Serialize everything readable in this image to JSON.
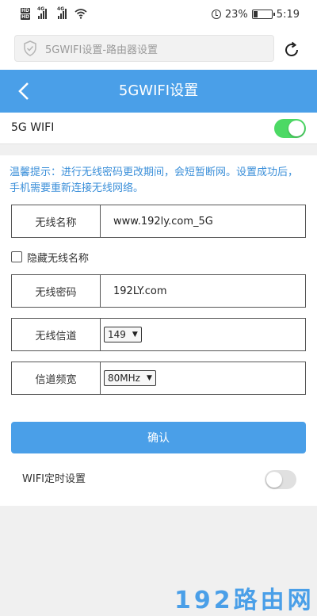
{
  "status_bar": {
    "hd1": "HD",
    "hd2": "HD",
    "net1": "4G",
    "net2": "4G",
    "battery": "23%",
    "battery_level": 0.23,
    "time": "5:19"
  },
  "address_bar": {
    "url_text": "5GWIFI设置-路由器设置"
  },
  "header": {
    "title": "5GWIFI设置"
  },
  "wifi_toggle": {
    "label": "5G WIFI",
    "enabled": true
  },
  "tip": "温馨提示：进行无线密码更改期间，会短暂断网。设置成功后，手机需要重新连接无线网络。",
  "form": {
    "ssid_label": "无线名称",
    "ssid_value": "www.192ly.com_5G",
    "hide_ssid_label": "隐藏无线名称",
    "hide_ssid_checked": false,
    "password_label": "无线密码",
    "password_value": "192LY.com",
    "channel_label": "无线信道",
    "channel_value": "149",
    "bandwidth_label": "信道频宽",
    "bandwidth_value": "80MHz"
  },
  "confirm_label": "确认",
  "timer": {
    "label": "WIFI定时设置",
    "enabled": false
  },
  "watermark": "192路由网",
  "colors": {
    "accent": "#4a9fe8",
    "toggle_on": "#4cd964",
    "tip_text": "#3b8fd9"
  }
}
